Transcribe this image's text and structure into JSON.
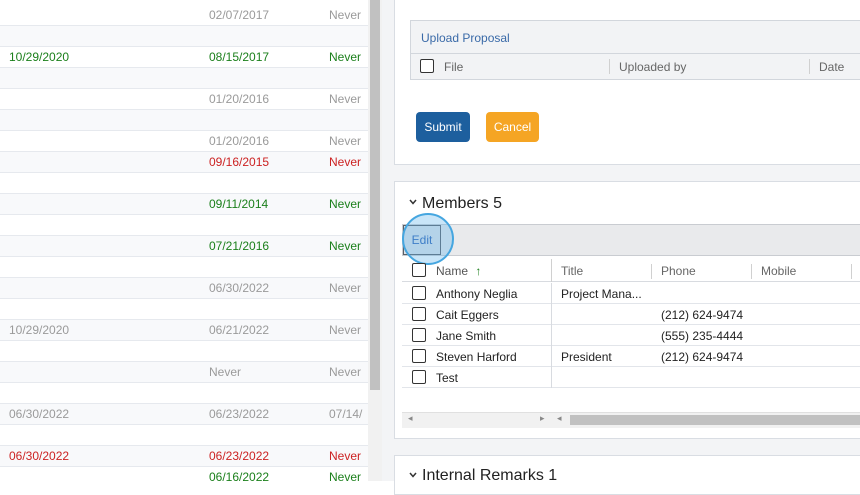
{
  "left_list": {
    "rows": [
      {
        "c1": "",
        "c2": "02/07/2017",
        "c2_color": "gray",
        "c3": "Never",
        "c3_color": "gray"
      },
      {
        "c1": "",
        "c2": "",
        "c2_color": "gray",
        "c3": "",
        "c3_color": "gray"
      },
      {
        "c1": "10/29/2020",
        "c1_color": "green",
        "c2": "08/15/2017",
        "c2_color": "green",
        "c3": "Never",
        "c3_color": "green"
      },
      {
        "c1": "",
        "c2": "",
        "c2_color": "gray",
        "c3": "",
        "c3_color": "gray"
      },
      {
        "c1": "",
        "c2": "01/20/2016",
        "c2_color": "gray",
        "c3": "Never",
        "c3_color": "gray"
      },
      {
        "c1": "",
        "c2": "",
        "c2_color": "gray",
        "c3": "",
        "c3_color": "gray"
      },
      {
        "c1": "",
        "c2": "01/20/2016",
        "c2_color": "gray",
        "c3": "Never",
        "c3_color": "gray"
      },
      {
        "c1": "",
        "c2": "09/16/2015",
        "c2_color": "red",
        "c3": "Never",
        "c3_color": "red"
      },
      {
        "c1": "",
        "c2": "",
        "c2_color": "gray",
        "c3": "",
        "c3_color": "gray"
      },
      {
        "c1": "",
        "c2": "09/11/2014",
        "c2_color": "green",
        "c3": "Never",
        "c3_color": "green"
      },
      {
        "c1": "",
        "c2": "",
        "c2_color": "gray",
        "c3": "",
        "c3_color": "gray"
      },
      {
        "c1": "",
        "c2": "07/21/2016",
        "c2_color": "green",
        "c3": "Never",
        "c3_color": "green"
      },
      {
        "c1": "",
        "c2": "",
        "c2_color": "gray",
        "c3": "",
        "c3_color": "gray"
      },
      {
        "c1": "",
        "c2": "06/30/2022",
        "c2_color": "gray",
        "c3": "Never",
        "c3_color": "gray"
      },
      {
        "c1": "",
        "c2": "",
        "c2_color": "gray",
        "c3": "",
        "c3_color": "gray"
      },
      {
        "c1": "10/29/2020",
        "c1_color": "gray",
        "c2": "06/21/2022",
        "c2_color": "gray",
        "c3": "Never",
        "c3_color": "gray"
      },
      {
        "c1": "",
        "c2": "",
        "c2_color": "gray",
        "c3": "",
        "c3_color": "gray"
      },
      {
        "c1": "",
        "c2": "Never",
        "c2_color": "gray",
        "c3": "Never",
        "c3_color": "gray"
      },
      {
        "c1": "",
        "c2": "",
        "c2_color": "gray",
        "c3": "",
        "c3_color": "gray"
      },
      {
        "c1": "06/30/2022",
        "c1_color": "gray",
        "c2": "06/23/2022",
        "c2_color": "gray",
        "c3": "07/14/",
        "c3_color": "gray"
      },
      {
        "c1": "",
        "c2": "",
        "c2_color": "gray",
        "c3": "",
        "c3_color": "gray"
      },
      {
        "c1": "06/30/2022",
        "c1_color": "red",
        "c2": "06/23/2022",
        "c2_color": "red",
        "c3": "Never",
        "c3_color": "red"
      },
      {
        "c1": "",
        "c2": "06/16/2022",
        "c2_color": "green",
        "c3": "Never",
        "c3_color": "green"
      }
    ]
  },
  "upload": {
    "title": "Upload Proposal",
    "columns": [
      "File",
      "Uploaded by",
      "Date"
    ]
  },
  "actions": {
    "submit_label": "Submit",
    "cancel_label": "Cancel"
  },
  "members": {
    "title": "Members 5",
    "edit_label": "Edit",
    "columns": {
      "name": "Name",
      "title": "Title",
      "phone": "Phone",
      "mobile": "Mobile"
    },
    "sort_indicator": "↑",
    "rows": [
      {
        "name": "Anthony Neglia",
        "title": "Project Mana...",
        "phone": "",
        "mobile": ""
      },
      {
        "name": "Cait Eggers",
        "title": "",
        "phone": "(212) 624-9474",
        "mobile": ""
      },
      {
        "name": "Jane Smith",
        "title": "",
        "phone": "(555) 235-4444",
        "mobile": ""
      },
      {
        "name": "Steven Harford",
        "title": "President",
        "phone": "(212) 624-9474",
        "mobile": ""
      },
      {
        "name": "Test",
        "title": "",
        "phone": "",
        "mobile": ""
      }
    ]
  },
  "remarks": {
    "title": "Internal Remarks 1"
  },
  "icons": {
    "chevron": "chevron-down-icon",
    "sort": "arrow-up-icon"
  },
  "colors": {
    "green": "#1a7f1a",
    "red": "#cc2222",
    "gray": "#9a9a9a",
    "submit": "#1d5f9e",
    "cancel": "#f5a524",
    "link": "#3a6aa8"
  }
}
